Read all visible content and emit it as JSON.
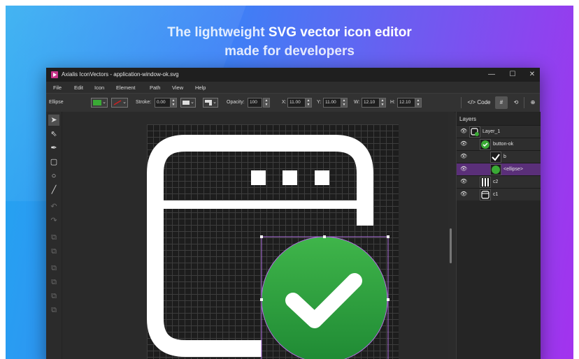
{
  "hero": {
    "line1_light": "The lightweight",
    "line1_bold": "SVG vector icon editor",
    "line2": "made for developers"
  },
  "window": {
    "title": "Axialis IconVectors - application-window-ok.svg",
    "controls": {
      "minimize": "—",
      "maximize": "☐",
      "close": "✕"
    }
  },
  "menu": [
    "File",
    "Edit",
    "Icon",
    "Element",
    "Path",
    "View",
    "Help"
  ],
  "toolbar": {
    "shape_label": "Ellipse",
    "stroke_label": "Stroke:",
    "stroke_value": "0.00",
    "opacity_label": "Opacity:",
    "opacity_value": "100",
    "x_label": "X:",
    "x_value": "11.00",
    "y_label": "Y:",
    "y_value": "11.00",
    "w_label": "W:",
    "w_value": "12.10",
    "h_label": "H:",
    "h_value": "12.10",
    "code_label": "Code",
    "fill_color": "#3aaa35",
    "stroke_color": "#d02020"
  },
  "tools": [
    "select-arrow-icon",
    "direct-select-icon",
    "pen-icon",
    "rectangle-icon",
    "ellipse-icon",
    "line-icon",
    "undo-icon",
    "redo-icon",
    "arrange-icon",
    "arrange-icon",
    "arrange-icon",
    "arrange-icon",
    "arrange-icon",
    "arrange-icon"
  ],
  "layers": {
    "title": "Layers",
    "rows": [
      {
        "label": "Layer_1",
        "indent": 0,
        "selected": false
      },
      {
        "label": "button-ok",
        "indent": 1,
        "selected": false
      },
      {
        "label": "b",
        "indent": 2,
        "selected": false
      },
      {
        "label": "<ellipse>",
        "indent": 2,
        "selected": true
      },
      {
        "label": "c2",
        "indent": 1,
        "selected": false
      },
      {
        "label": "c1",
        "indent": 1,
        "selected": false
      }
    ]
  },
  "colors": {
    "accent": "#a04ad8",
    "ok_green": "#3aaa35",
    "selection": "#5a2f79"
  }
}
